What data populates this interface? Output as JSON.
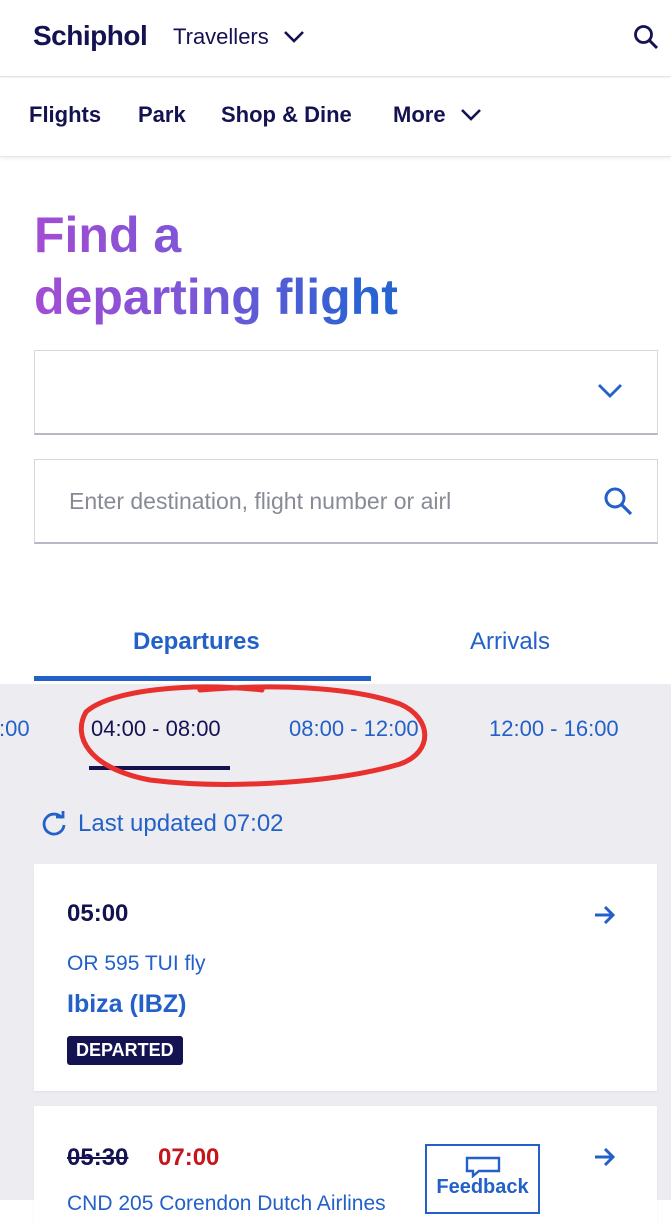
{
  "header": {
    "logo": "Schiphol",
    "audience_label": "Travellers"
  },
  "nav": {
    "items": [
      {
        "label": "Flights"
      },
      {
        "label": "Park"
      },
      {
        "label": "Shop & Dine"
      },
      {
        "label": "More"
      }
    ]
  },
  "page": {
    "title_line1": "Find a",
    "title_line2a": "departing",
    "title_line2b": "flight"
  },
  "filters": {
    "date_select_value": "",
    "search_placeholder": "Enter destination, flight number or airl"
  },
  "tabs": [
    {
      "label": "Departures",
      "active": true
    },
    {
      "label": "Arrivals",
      "active": false
    }
  ],
  "time_slots": [
    {
      "label": ":00"
    },
    {
      "label": "04:00 - 08:00",
      "active": true
    },
    {
      "label": "08:00 - 12:00"
    },
    {
      "label": "12:00 - 16:00"
    }
  ],
  "last_updated": "Last updated 07:02",
  "flights": [
    {
      "time": "05:00",
      "flight_number": "OR 595 TUI fly",
      "destination": "Ibiza (IBZ)",
      "status": "DEPARTED"
    },
    {
      "scheduled_time": "05:30",
      "expected_time": "07:00",
      "flight_number": "CND 205 Corendon Dutch Airlines"
    }
  ],
  "feedback_label": "Feedback",
  "colors": {
    "navy": "#141251",
    "blue": "#2360c8",
    "delay_red": "#c4151c",
    "annotation_red": "#e8312e",
    "panel_bg": "#ededf1"
  },
  "icons": [
    "chevron-down-icon",
    "search-icon",
    "refresh-icon",
    "arrow-right-icon",
    "chat-bubble-icon"
  ]
}
